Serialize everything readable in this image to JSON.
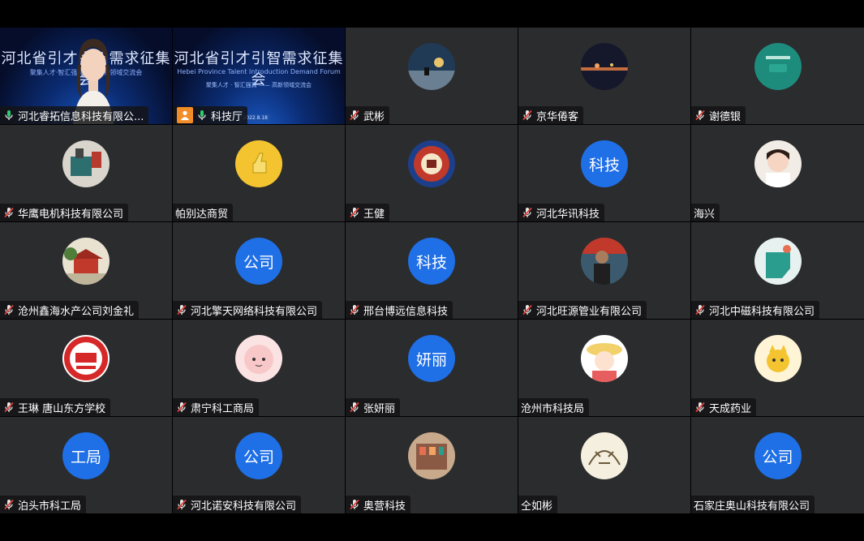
{
  "colors": {
    "tile_bg": "#2b2c2e",
    "avatar_blue": "#1f6fe6",
    "mic_red": "#e0433a",
    "mic_green": "#2ecc71",
    "host_orange": "#f28c28"
  },
  "participants": [
    {
      "name": "河北睿拓信息科技有限公...",
      "mic": "mic-on-icon",
      "type": "video-speaker",
      "video_title": "河北省引才引智需求征集会",
      "video_subtitle": "聚集人才·智汇强冀——高新领域交流会"
    },
    {
      "name": "科技厅",
      "mic": "mic-on-icon",
      "type": "video-slide",
      "host": "host-icon",
      "video_title": "河北省引才引智需求征集会",
      "video_subtitle": "Hebei Province Talent Introduction Demand Forum",
      "video_line": "聚集人才 · 智汇强冀 —— 高新领域交流会",
      "video_date": "2022.8.18"
    },
    {
      "name": "武彬",
      "mic": "mic-muted-icon",
      "type": "photo",
      "photo": "night-sky-photo"
    },
    {
      "name": "京华倦客",
      "mic": "mic-muted-icon",
      "type": "photo",
      "photo": "night-lights-photo"
    },
    {
      "name": "谢德银",
      "mic": "mic-muted-icon",
      "type": "photo",
      "photo": "teal-card-photo"
    },
    {
      "name": "华鹰电机科技有限公司",
      "mic": "mic-muted-icon",
      "type": "photo",
      "photo": "machine-photo"
    },
    {
      "name": "帕别达商贸",
      "mic": "none",
      "type": "photo",
      "photo": "thumbs-up-photo"
    },
    {
      "name": "王健",
      "mic": "mic-muted-icon",
      "type": "photo",
      "photo": "emblem-logo"
    },
    {
      "name": "河北华讯科技",
      "mic": "mic-muted-icon",
      "type": "text",
      "avatar_text": "科技"
    },
    {
      "name": "海兴",
      "mic": "none",
      "type": "photo",
      "photo": "child-photo"
    },
    {
      "name": "沧州鑫海水产公司刘金礼",
      "mic": "mic-muted-icon",
      "type": "photo",
      "photo": "temple-photo"
    },
    {
      "name": "河北擎天网络科技有限公司",
      "mic": "mic-muted-icon",
      "type": "text",
      "avatar_text": "公司"
    },
    {
      "name": "邢台博远信息科技",
      "mic": "mic-muted-icon",
      "type": "text",
      "avatar_text": "科技"
    },
    {
      "name": "河北旺源管业有限公司",
      "mic": "mic-muted-icon",
      "type": "photo",
      "photo": "man-photo"
    },
    {
      "name": "河北中磁科技有限公司",
      "mic": "mic-muted-icon",
      "type": "photo",
      "photo": "cartoon-photo"
    },
    {
      "name": "王琳 唐山东方学校",
      "mic": "mic-muted-icon",
      "type": "photo",
      "photo": "school-logo"
    },
    {
      "name": "肃宁科工商局",
      "mic": "mic-muted-icon",
      "type": "photo",
      "photo": "pink-face-photo"
    },
    {
      "name": "张妍丽",
      "mic": "mic-muted-icon",
      "type": "text",
      "avatar_text": "妍丽"
    },
    {
      "name": "沧州市科技局",
      "mic": "none",
      "type": "photo",
      "photo": "anime-girl-photo"
    },
    {
      "name": "天成药业",
      "mic": "mic-muted-icon",
      "type": "photo",
      "photo": "cat-sticker-photo"
    },
    {
      "name": "泊头市科工局",
      "mic": "mic-muted-icon",
      "type": "text",
      "avatar_text": "工局"
    },
    {
      "name": "河北诺安科技有限公司",
      "mic": "mic-muted-icon",
      "type": "text",
      "avatar_text": "公司"
    },
    {
      "name": "奥营科技",
      "mic": "mic-muted-icon",
      "type": "photo",
      "photo": "shop-photo"
    },
    {
      "name": "仝如彬",
      "mic": "none",
      "type": "photo",
      "photo": "tiger-sketch-photo"
    },
    {
      "name": "石家庄奥山科技有限公司",
      "mic": "none",
      "type": "text",
      "avatar_text": "公司"
    }
  ]
}
